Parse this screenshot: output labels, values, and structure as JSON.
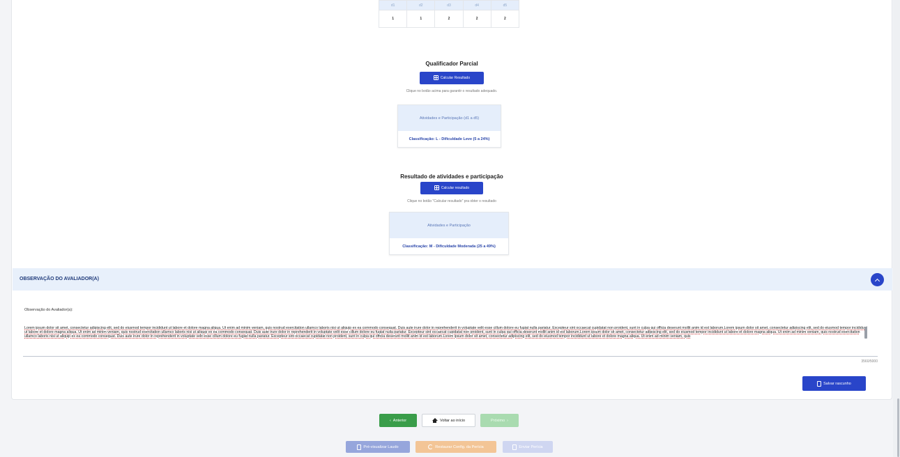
{
  "domains_table": {
    "headers": [
      "d1",
      "d2",
      "d3",
      "d4",
      "d5"
    ],
    "values": [
      "1",
      "1",
      "2",
      "2",
      "2"
    ]
  },
  "partial": {
    "title": "Qualificador Parcial",
    "button_label": "Calcular Resultado",
    "hint": "Clique no botão acima para garantir o resultado adequado.",
    "box_title": "Atividades e Participação (d1 a d5)",
    "classification": "Classificação: L - Dificuldade Leve (5 a 24%)"
  },
  "result": {
    "title": "Resultado de atividades e participação",
    "button_label": "Calcular resultado",
    "hint": "Clique no botão \"Calcular resultado\" pra obter o resultado",
    "box_title": "Atividades e Participação",
    "classification": "Classificação: M - Dificuldade Moderada (25 a 49%)"
  },
  "observation": {
    "section_title": "OBSERVAÇÃO DO AVALIADOR(A)",
    "field_label": "Observação do Avaliador(a):",
    "text": "Lorem ipsum dolor sit amet, consectetur adipiscing elit, sed do eiusmod tempor incididunt ut labore et dolore magna aliqua. Ut enim ad minim veniam, quis nostrud exercitation ullamco laboris nisi ut aliquip ex ea commodo consequat. Duis aute irure dolor in reprehenderit in voluptate velit esse cillum dolore eu fugiat nulla pariatur. Excepteur sint occaecat cupidatat non proident, sunt in culpa qui officia deserunt mollit anim id est laborum.Lorem ipsum dolor sit amet, consectetur adipiscing elit, sed do eiusmod tempor incididunt ut labore et dolore magna aliqua. Ut enim ad minim veniam, quis nostrud exercitation ullamco laboris nisi ut aliquip ex ea commodo consequat. Duis aute irure dolor in reprehenderit in voluptate velit esse cillum dolore eu fugiat nulla pariatur. Excepteur sint occaecat cupidatat non proident, sunt in culpa qui officia deserunt mollit anim id est laborum.Lorem ipsum dolor sit amet, consectetur adipiscing elit, sed do eiusmod tempor incididunt ut labore et dolore magna aliqua. Ut enim ad minim veniam, quis nostrud exercitation ullamco laboris nisi ut aliquip ex ea commodo consequat. Duis aute irure dolor in reprehenderit in voluptate velit esse cillum dolore eu fugiat nulla pariatur. Excepteur sint occaecat cupidatat non proident, sunt in culpa qui officia deserunt mollit anim id est laborum.Lorem ipsum dolor sit amet, consectetur adipiscing elit, sed do eiusmod tempor incididunt ut labore et dolore magna aliqua. Ut enim ad minim veniam, quis",
    "counter": "3560/5000",
    "save_label": "Salvar rascunho"
  },
  "nav": {
    "prev_label": "Anterior",
    "home_label": "Voltar ao início",
    "next_label": "Próximo"
  },
  "actions": {
    "preview_label": "Pré-visualizar Laudo",
    "restore_label": "Restaurar Config. da Perícia",
    "send_label": "Enviar Perícia"
  },
  "colors": {
    "primary": "#2945c9",
    "success": "#3a9d4a",
    "warning": "#f3c596",
    "header_bg": "#e8f0fb"
  }
}
